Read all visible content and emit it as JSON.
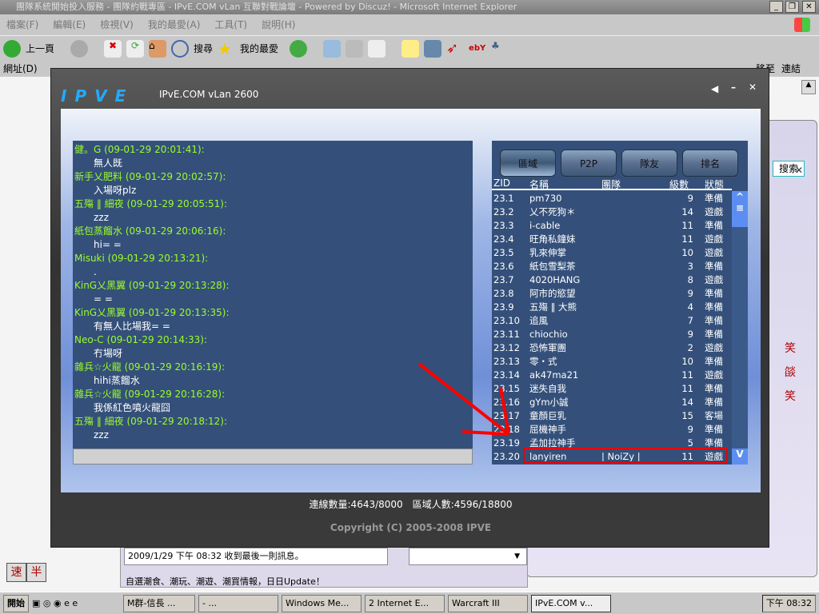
{
  "browser": {
    "title": "團隊系統開始投入服務 - 團隊約戰專區 - IPvE.COM vLan 互聯對戰論壇 - Powered by Discuz! - Microsoft Internet Explorer",
    "menu": [
      "檔案(F)",
      "編輯(E)",
      "檢視(V)",
      "我的最愛(A)",
      "工具(T)",
      "說明(H)"
    ],
    "toolbar": {
      "back": "上一頁",
      "search": "搜尋",
      "favorites": "我的最愛"
    },
    "address_label": "網址(D)",
    "go": "移至",
    "links": "連結"
  },
  "app": {
    "title": "IPvE.COM vLan 2600",
    "logo": "IPVE",
    "chat": [
      {
        "user": "健。G (09-01-29 20:01:41):",
        "msg": "無人既"
      },
      {
        "user": "新手乂肥料 (09-01-29 20:02:57):",
        "msg": "入場呀plz"
      },
      {
        "user": "五殤 ‖ 細夜 (09-01-29 20:05:51):",
        "msg": "zzz"
      },
      {
        "user": "紙包蒸餾水 (09-01-29 20:06:16):",
        "msg": "hi= ="
      },
      {
        "user": "Misuki (09-01-29 20:13:21):",
        "msg": "."
      },
      {
        "user": "KinG乂黑翼 (09-01-29 20:13:28):",
        "msg": "= ="
      },
      {
        "user": "KinG乂黑翼 (09-01-29 20:13:35):",
        "msg": "有無人比場我= ="
      },
      {
        "user": "Neo-C (09-01-29 20:14:33):",
        "msg": "冇場呀"
      },
      {
        "user": "雜兵☆火龍 (09-01-29 20:16:19):",
        "msg": "hihi蒸餾水"
      },
      {
        "user": "雜兵☆火龍 (09-01-29 20:16:28):",
        "msg": "我係紅色噴火龍囧"
      },
      {
        "user": "五殤 ‖ 細夜 (09-01-29 20:18:12):",
        "msg": "zzz"
      }
    ],
    "tabs": [
      "區域",
      "P2P",
      "隊友",
      "排名"
    ],
    "columns": [
      "ZID",
      "名稱",
      "團隊",
      "級數",
      "狀態"
    ],
    "rows": [
      [
        "23.1",
        "pm730",
        "",
        "9",
        "準備"
      ],
      [
        "23.2",
        "乂不死狗＊",
        "",
        "14",
        "遊戲"
      ],
      [
        "23.3",
        "i-cable",
        "",
        "11",
        "準備"
      ],
      [
        "23.4",
        "旺角私鐘妹",
        "",
        "11",
        "遊戲"
      ],
      [
        "23.5",
        "乳來伸掌",
        "",
        "10",
        "遊戲"
      ],
      [
        "23.6",
        "紙包雪梨茶",
        "",
        "3",
        "準備"
      ],
      [
        "23.7",
        "4020HANG",
        "",
        "8",
        "遊戲"
      ],
      [
        "23.8",
        "阿市的慾望",
        "",
        "9",
        "準備"
      ],
      [
        "23.9",
        "五殤 ‖ 大熊",
        "",
        "4",
        "準備"
      ],
      [
        "23.10",
        "追風",
        "",
        "7",
        "準備"
      ],
      [
        "23.11",
        "chiochio",
        "",
        "9",
        "準備"
      ],
      [
        "23.12",
        "恐怖軍團",
        "",
        "2",
        "遊戲"
      ],
      [
        "23.13",
        "零・式",
        "",
        "10",
        "準備"
      ],
      [
        "23.14",
        "ak47ma21",
        "",
        "11",
        "遊戲"
      ],
      [
        "23.15",
        "迷失自我",
        "",
        "11",
        "準備"
      ],
      [
        "23.16",
        "gYm小誠",
        "",
        "14",
        "準備"
      ],
      [
        "23.17",
        "童顏巨乳",
        "",
        "15",
        "客場"
      ],
      [
        "23.18",
        "屈機神手",
        "",
        "9",
        "準備"
      ],
      [
        "23.19",
        "孟加拉神手",
        "",
        "5",
        "準備"
      ],
      [
        "23.20",
        "lanyiren",
        "| NoiZy |",
        "11",
        "遊戲"
      ]
    ],
    "status": "連線數量:4643/8000　區域人數:4596/18800",
    "copyright": "Copyright (C) 2005-2008 IPVE"
  },
  "background": {
    "search_btn": "搜索",
    "msg_status": "2009/1/29 下午 08:32 收到最後一則訊息。",
    "ad": "自選潮食、潮玩、潮遊、潮買情報，日日Update！",
    "ime": [
      "速",
      "半"
    ]
  },
  "taskbar": {
    "start": "開始",
    "items": [
      "M群-信長 ...",
      "- ...",
      "Windows Me...",
      "2 Internet E...",
      "Warcraft III",
      "IPvE.COM v..."
    ],
    "clock": "下午 08:32"
  },
  "colors": {
    "highlight": "#ff0000",
    "username": "#9cfc2a"
  }
}
